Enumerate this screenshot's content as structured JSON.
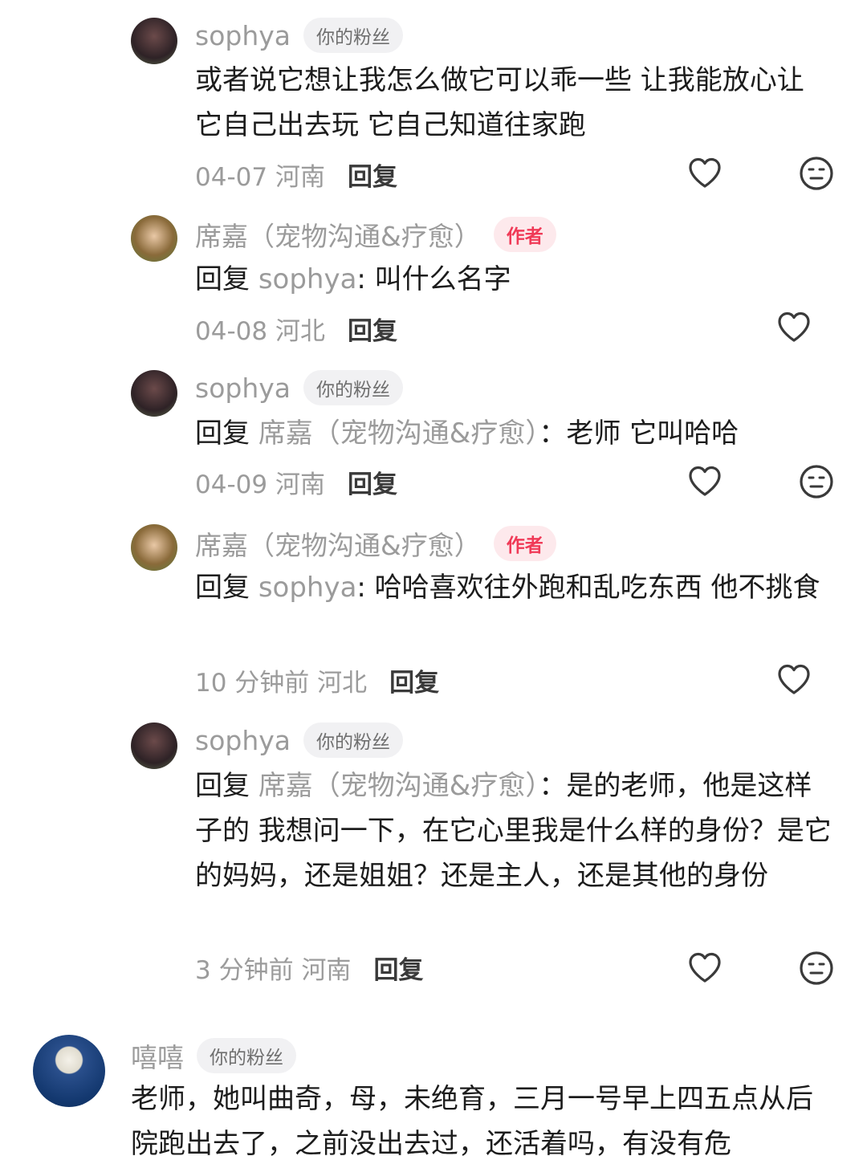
{
  "comments": [
    {
      "name": "sophya",
      "badge": "你的粉丝",
      "text": "或者说它想让我怎么做它可以乖一些 让我能放心让它自己出去玩 它自己知道往家跑",
      "time": "04-07",
      "region": "河南",
      "reply": "回复"
    },
    {
      "name": "席嘉（宠物沟通&疗愈）",
      "badge": "作者",
      "reply_prefix": "回复",
      "reply_target": "sophya",
      "text": ": 叫什么名字",
      "time": "04-08",
      "region": "河北",
      "reply": "回复"
    },
    {
      "name": "sophya",
      "badge": "你的粉丝",
      "reply_prefix": "回复",
      "reply_target": "席嘉（宠物沟通&疗愈）",
      "text": "：老师  它叫哈哈",
      "time": "04-09",
      "region": "河南",
      "reply": "回复"
    },
    {
      "name": "席嘉（宠物沟通&疗愈）",
      "badge": "作者",
      "reply_prefix": "回复",
      "reply_target": "sophya",
      "text": ": 哈哈喜欢往外跑和乱吃东西 他不挑食",
      "time": "10 分钟前",
      "region": "河北",
      "reply": "回复"
    },
    {
      "name": "sophya",
      "badge": "你的粉丝",
      "reply_prefix": "回复",
      "reply_target": "席嘉（宠物沟通&疗愈）",
      "text": "：是的老师，他是这样子的  我想问一下，在它心里我是什么样的身份？是它的妈妈，还是姐姐？还是主人，还是其他的身份",
      "time": "3 分钟前",
      "region": "河南",
      "reply": "回复"
    },
    {
      "name": "嘻嘻",
      "badge": "你的粉丝",
      "text": "老师，她叫曲奇，母，未绝育，三月一号早上四五点从后院跑出去了，之前没出去过，还活着吗，有没有危"
    }
  ],
  "icons": {
    "like": "heart-outline-icon",
    "dislike": "meh-face-icon"
  },
  "colors": {
    "author_badge_text": "#f03a57",
    "author_badge_bg": "#fde9ec",
    "meta_gray": "#9b9b9b"
  }
}
